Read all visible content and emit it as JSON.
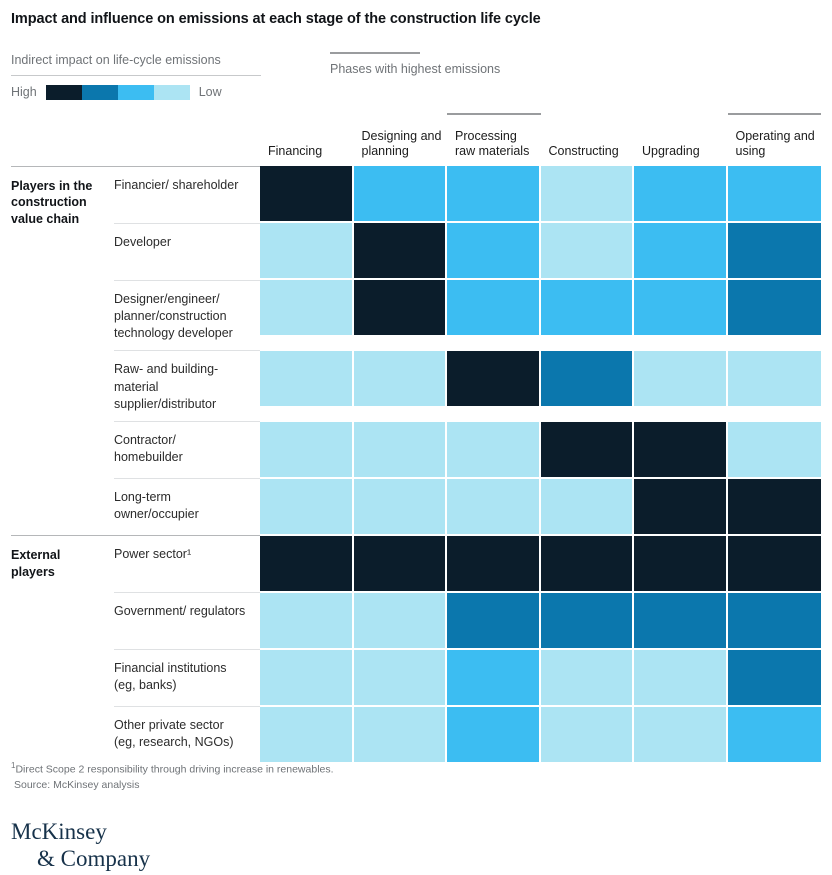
{
  "title": "Impact and influence on emissions at each stage of the construction life cycle",
  "legend": {
    "caption": "Indirect impact on life-cycle emissions",
    "high_label": "High",
    "low_label": "Low",
    "swatches": [
      {
        "name": "level-1-high",
        "color": "#0b1d2b"
      },
      {
        "name": "level-2",
        "color": "#0b77ad"
      },
      {
        "name": "level-3",
        "color": "#3cbdf2"
      },
      {
        "name": "level-4-low",
        "color": "#ace4f3"
      }
    ]
  },
  "phases_key": {
    "label": "Phases with highest emissions",
    "marker_color": "#9a9c9e"
  },
  "columns": [
    {
      "label": "Financing",
      "highlight": false
    },
    {
      "label": "Designing and planning",
      "highlight": false
    },
    {
      "label": "Processing raw materials",
      "highlight": true
    },
    {
      "label": "Constructing",
      "highlight": false
    },
    {
      "label": "Upgrading",
      "highlight": false
    },
    {
      "label": "Operating and using",
      "highlight": true
    }
  ],
  "groups": [
    {
      "name": "Players in the construction value chain",
      "rows": [
        {
          "label": "Financier/ shareholder",
          "values": [
            1,
            3,
            3,
            4,
            3,
            3
          ]
        },
        {
          "label": "Developer",
          "values": [
            4,
            1,
            3,
            4,
            3,
            2
          ]
        },
        {
          "label": "Designer/engineer/ planner/construction technology developer",
          "values": [
            4,
            1,
            3,
            3,
            3,
            2
          ]
        },
        {
          "label": "Raw- and building-material supplier/distributor",
          "values": [
            4,
            4,
            1,
            2,
            4,
            4
          ]
        },
        {
          "label": "Contractor/ homebuilder",
          "values": [
            4,
            4,
            4,
            1,
            1,
            4
          ]
        },
        {
          "label": "Long-term owner/occupier",
          "values": [
            4,
            4,
            4,
            4,
            1,
            1
          ]
        }
      ]
    },
    {
      "name": "External players",
      "rows": [
        {
          "label": "Power sector¹",
          "values": [
            1,
            1,
            1,
            1,
            1,
            1
          ]
        },
        {
          "label": "Government/ regulators",
          "values": [
            4,
            4,
            2,
            2,
            2,
            2
          ]
        },
        {
          "label": "Financial institutions (eg, banks)",
          "values": [
            4,
            4,
            3,
            4,
            4,
            2
          ]
        },
        {
          "label": "Other private sector (eg, research, NGOs)",
          "values": [
            4,
            4,
            3,
            4,
            4,
            3
          ]
        }
      ]
    }
  ],
  "footnotes": {
    "note": "Direct Scope 2 responsibility through driving increase in renewables.",
    "note_marker": "1",
    "source": "Source: McKinsey analysis"
  },
  "logo": {
    "line1": "McKinsey",
    "line2": "& Company"
  },
  "chart_data": {
    "type": "heatmap",
    "title": "Impact and influence on emissions at each stage of the construction life cycle",
    "xlabel": "",
    "ylabel": "",
    "legend_position": "top-left",
    "grid": true,
    "scale": {
      "name": "Indirect impact on life-cycle emissions",
      "direction": "1 = High impact, 4 = Low impact",
      "levels": [
        {
          "level": 1,
          "label": "High",
          "color": "#0b1d2b"
        },
        {
          "level": 2,
          "label": "",
          "color": "#0b77ad"
        },
        {
          "level": 3,
          "label": "",
          "color": "#3cbdf2"
        },
        {
          "level": 4,
          "label": "Low",
          "color": "#ace4f3"
        }
      ]
    },
    "x_categories": [
      "Financing",
      "Designing and planning",
      "Processing raw materials",
      "Constructing",
      "Upgrading",
      "Operating and using"
    ],
    "x_categories_highlighted": [
      "Processing raw materials",
      "Operating and using"
    ],
    "y_categories": [
      "Financier/shareholder",
      "Developer",
      "Designer/engineer/planner/construction technology developer",
      "Raw- and building-material supplier/distributor",
      "Contractor/homebuilder",
      "Long-term owner/occupier",
      "Power sector",
      "Government/regulators",
      "Financial institutions (eg, banks)",
      "Other private sector (eg, research, NGOs)"
    ],
    "values": [
      [
        1,
        3,
        3,
        4,
        3,
        3
      ],
      [
        4,
        1,
        3,
        4,
        3,
        2
      ],
      [
        4,
        1,
        3,
        3,
        3,
        2
      ],
      [
        4,
        4,
        1,
        2,
        4,
        4
      ],
      [
        4,
        4,
        4,
        1,
        1,
        4
      ],
      [
        4,
        4,
        4,
        4,
        1,
        1
      ],
      [
        1,
        1,
        1,
        1,
        1,
        1
      ],
      [
        4,
        4,
        2,
        2,
        2,
        2
      ],
      [
        4,
        4,
        3,
        4,
        4,
        2
      ],
      [
        4,
        4,
        3,
        4,
        4,
        3
      ]
    ]
  }
}
